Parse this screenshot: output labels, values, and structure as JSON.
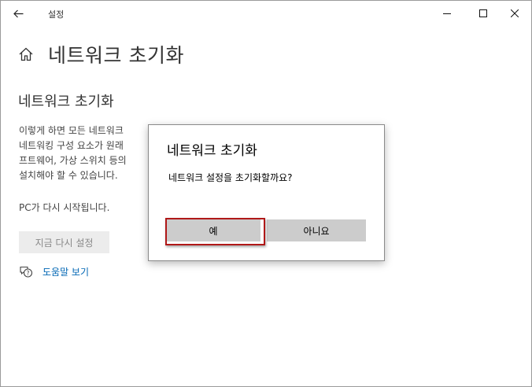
{
  "window": {
    "app_title": "설정",
    "back_icon": "arrow-left-icon",
    "controls": [
      "minimize-icon",
      "maximize-icon",
      "close-icon"
    ]
  },
  "page": {
    "home_icon": "home-icon",
    "title": "네트워크 초기화",
    "section_title": "네트워크 초기화",
    "description_lines": [
      "이렇게 하면 모든 네트워크",
      "네트워킹 구성 요소가 원래",
      "프트웨어, 가상 스위치 등의",
      "설치해야 할 수 있습니다."
    ],
    "restart_note": "PC가 다시 시작됩니다.",
    "reset_button": "지금 다시 설정",
    "help_link": "도움말 보기",
    "help_icon": "help-chat-icon",
    "link_color": "#0066b4"
  },
  "dialog": {
    "title": "네트워크 초기화",
    "message": "네트워크 설정을 초기화할까요?",
    "yes_label": "예",
    "no_label": "아니요",
    "highlight_color": "#b01818"
  }
}
